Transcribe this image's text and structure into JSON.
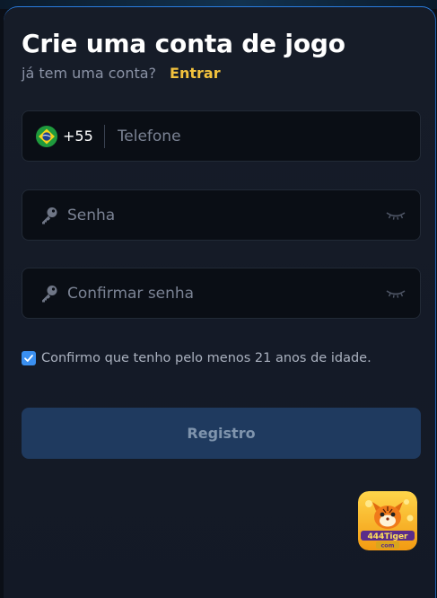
{
  "form": {
    "title": "Crie uma conta de jogo",
    "subtitle": "já tem uma conta?",
    "login_link": "Entrar",
    "phone": {
      "country_code": "+55",
      "flag": "brazil-flag",
      "placeholder": "Telefone",
      "value": ""
    },
    "password": {
      "placeholder": "Senha",
      "value": "",
      "icon": "key-icon",
      "toggle_icon": "eye-closed-icon"
    },
    "confirm_password": {
      "placeholder": "Confirmar senha",
      "value": "",
      "icon": "key-icon",
      "toggle_icon": "eye-closed-icon"
    },
    "age_confirm": {
      "label": "Confirmo que tenho pelo menos 21 anos de idade.",
      "checked": true
    },
    "submit_label": "Registro"
  },
  "logo": {
    "text_line1": "444Tiger",
    "text_line2": "com"
  },
  "colors": {
    "background": "#0b0f17",
    "card": "#161c28",
    "accent": "#3a8ff0",
    "link": "#f3c23d",
    "button": "#1f3a5f",
    "button_text": "#7f94ad"
  }
}
